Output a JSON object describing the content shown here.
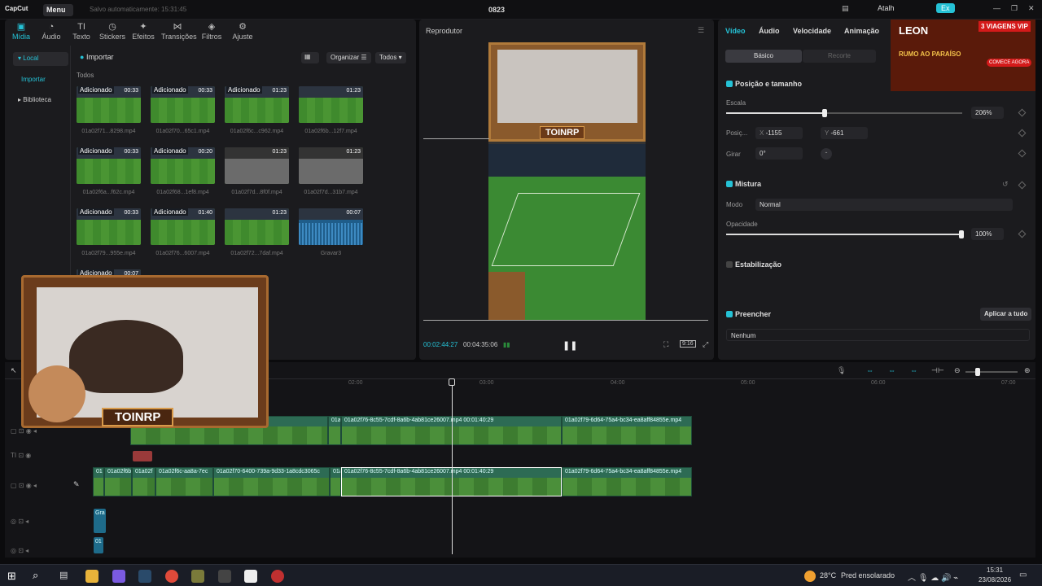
{
  "app": {
    "logo": "CapCut",
    "menu": "Menu",
    "saved": "Salvo automaticamente: 15:31:45",
    "project": "0823"
  },
  "toolbar": [
    "Mídia",
    "Áudio",
    "Texto",
    "Stickers",
    "Efeitos",
    "Transições",
    "Filtros",
    "Ajuste"
  ],
  "sidebar": [
    "Local",
    "Importar",
    "Biblioteca"
  ],
  "media": {
    "import": "Importar",
    "organize": "Organizar",
    "all_btn": "Todos",
    "section": "Todos",
    "items": [
      {
        "tag": "Adicionado",
        "dur": "00:33",
        "name": "01a02f71...8298.mp4"
      },
      {
        "tag": "Adicionado",
        "dur": "00:33",
        "name": "01a02f70...65c1.mp4"
      },
      {
        "tag": "Adicionado",
        "dur": "01:23",
        "name": "01a02f6c...c962.mp4"
      },
      {
        "tag": "",
        "dur": "01:23",
        "name": "01a02f6b...12f7.mp4"
      },
      {
        "tag": "Adicionado",
        "dur": "00:33",
        "name": "01a02f6a...f62c.mp4"
      },
      {
        "tag": "Adicionado",
        "dur": "00:20",
        "name": "01a02f68...1ef8.mp4"
      },
      {
        "tag": "",
        "dur": "01:23",
        "name": "01a02f7d...8f0f.mp4"
      },
      {
        "tag": "",
        "dur": "01:23",
        "name": "01a02f7d...31b7.mp4"
      },
      {
        "tag": "Adicionado",
        "dur": "00:33",
        "name": "01a02f79...955e.mp4"
      },
      {
        "tag": "Adicionado",
        "dur": "01:40",
        "name": "01a02f76...6007.mp4"
      },
      {
        "tag": "",
        "dur": "01:23",
        "name": "01a02f72...7daf.mp4"
      },
      {
        "tag": "",
        "dur": "00:07",
        "name": "Gravar3"
      },
      {
        "tag": "Adicionado",
        "dur": "00:07",
        "name": ""
      }
    ]
  },
  "player": {
    "title": "Reprodutor",
    "current": "00:02:44:27",
    "total": "00:04:35:06",
    "ratio": "9:16",
    "overlay_text": "TOINRP"
  },
  "props": {
    "tabs": [
      "Vídeo",
      "Áudio",
      "Velocidade",
      "Animação",
      "R"
    ],
    "sub_tabs": [
      "Básico",
      "Recorte"
    ],
    "pos_title": "Posição e tamanho",
    "scale_label": "Escala",
    "scale_val": "206%",
    "pos_label": "Posiç...",
    "x_lbl": "X",
    "x_val": "-1155",
    "y_lbl": "Y",
    "y_val": "-661",
    "rot_label": "Girar",
    "rot_val": "0°",
    "rot_dash": "-",
    "blend_title": "Mistura",
    "mode_label": "Modo",
    "mode_val": "Normal",
    "opacity_label": "Opacidade",
    "opacity_val": "100%",
    "stab_title": "Estabilização",
    "fill_title": "Preencher",
    "apply_all": "Aplicar a tudo",
    "fill_val": "Nenhum"
  },
  "ad": {
    "brand": "LEON",
    "export": "Ex",
    "atalho": "Atalh",
    "line1": "3 VIAGENS VIP",
    "line2": "RUMO AO PARAÍSO",
    "cta": "COMECE AGORA"
  },
  "timeline": {
    "ruler": [
      "02:00",
      "03:00",
      "04:00",
      "05:00",
      "06:00",
      "07:00"
    ],
    "track1": [
      {
        "label": "0-9d33-1a8cdc3065c"
      },
      {
        "label": "01a"
      },
      {
        "label": "01a02f76-8c55-7cdf-8a6b-4ab81ce26007.mp4   00:01:40:29"
      },
      {
        "label": "01a02f79-6d64-75a4-bc34-ea8aff84855e.mp4"
      }
    ],
    "track2": [
      {
        "label": "01"
      },
      {
        "label": "01a02f6b"
      },
      {
        "label": "01a02f"
      },
      {
        "label": "01a02f6c-aa8a-7ec"
      },
      {
        "label": "01a02f70-6400-739a-9d33-1a8cdc3065c"
      },
      {
        "label": "01a"
      },
      {
        "label": "01a02f76-8c55-7cdf-8a6b-4ab81ce26007.mp4   00:01:40:29"
      },
      {
        "label": "01a02f79-6d64-75a4-bc34-ea8aff84855e.mp4"
      }
    ],
    "audio1": "Gra",
    "audio2": "01"
  },
  "taskbar": {
    "temp": "28°C",
    "weather": "Pred ensolarado",
    "time": "15:31",
    "date": "23/08/2026"
  }
}
